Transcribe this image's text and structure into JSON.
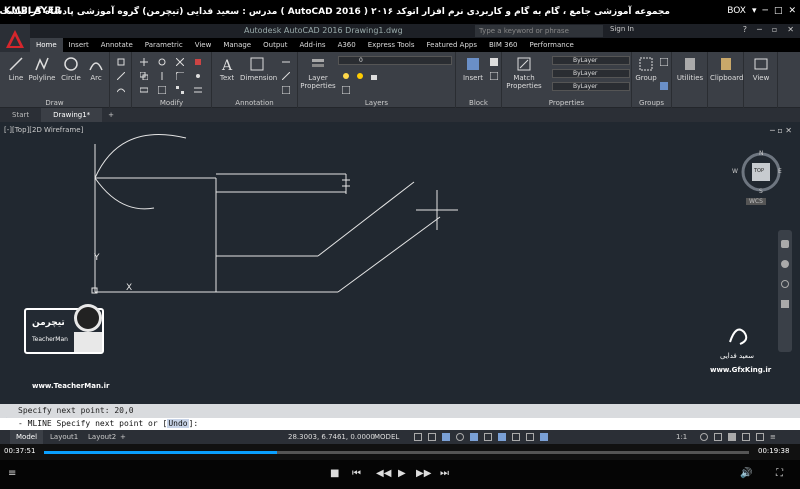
{
  "player": {
    "logo": "KMPLAYER",
    "title": "مجموعه آموزشی جامع ، گام به گام و کاربردی نرم افزار اتوکد ۲۰۱۶ ( AutoCAD 2016 ) مدرس : سعید فدایی (تیچرمن) گروه آموزشی پادشاه گرافیست ها",
    "box_label": "BOX",
    "time_current": "00:37:51",
    "time_total": "00:19:38",
    "progress_fraction": 0.33
  },
  "cad": {
    "document_title": "Autodesk AutoCAD 2016  Drawing1.dwg",
    "search_placeholder": "Type a keyword or phrase",
    "sign_in": "Sign In",
    "tabs": [
      "Home",
      "Insert",
      "Annotate",
      "Parametric",
      "View",
      "Manage",
      "Output",
      "Add-ins",
      "A360",
      "Express Tools",
      "Featured Apps",
      "BIM 360",
      "Performance"
    ],
    "ribbon": {
      "draw": {
        "label": "Draw",
        "line": "Line",
        "polyline": "Polyline",
        "circle": "Circle",
        "arc": "Arc"
      },
      "modify": {
        "label": "Modify"
      },
      "annotation": {
        "label": "Annotation",
        "text": "Text",
        "dimension": "Dimension"
      },
      "layers": {
        "label": "Layers",
        "layer_properties": "Layer\nProperties",
        "layer_value": "0"
      },
      "block": {
        "label": "Block",
        "insert": "Insert"
      },
      "properties": {
        "label": "Properties",
        "match": "Match\nProperties",
        "bylayer1": "ByLayer",
        "bylayer2": "ByLayer",
        "bylayer3": "ByLayer"
      },
      "groups": {
        "label": "Groups",
        "group": "Group"
      },
      "utilities": "Utilities",
      "clipboard": "Clipboard",
      "view": "View"
    },
    "file_tabs": [
      "Start",
      "Drawing1*"
    ],
    "view_label": "[-][Top][2D Wireframe]",
    "viewcube": {
      "top": "TOP",
      "north": "N",
      "south": "S",
      "east": "E",
      "west": "W",
      "wcs": "WCS"
    },
    "watermark_left": {
      "name": "TeacherMan",
      "url": "www.TeacherMan.ir",
      "persian": "تیچرمن"
    },
    "watermark_right": {
      "name": "سعید فدایی",
      "url": "www.GfxKing.ir"
    },
    "command": {
      "history": "Specify next point:  20,0",
      "prompt_prefix": "- MLINE Specify next point or [",
      "undo": "Undo",
      "prompt_suffix": "]:"
    },
    "status": {
      "layouts": [
        "Model",
        "Layout1",
        "Layout2"
      ],
      "coords": "28.3003, 6.7461, 0.0000",
      "model": "MODEL",
      "scale": "1:1"
    }
  },
  "colors": {
    "accent": "#0aa0ff",
    "ribbon_bg": "#3b3f46",
    "drawing_bg": "#212830"
  }
}
